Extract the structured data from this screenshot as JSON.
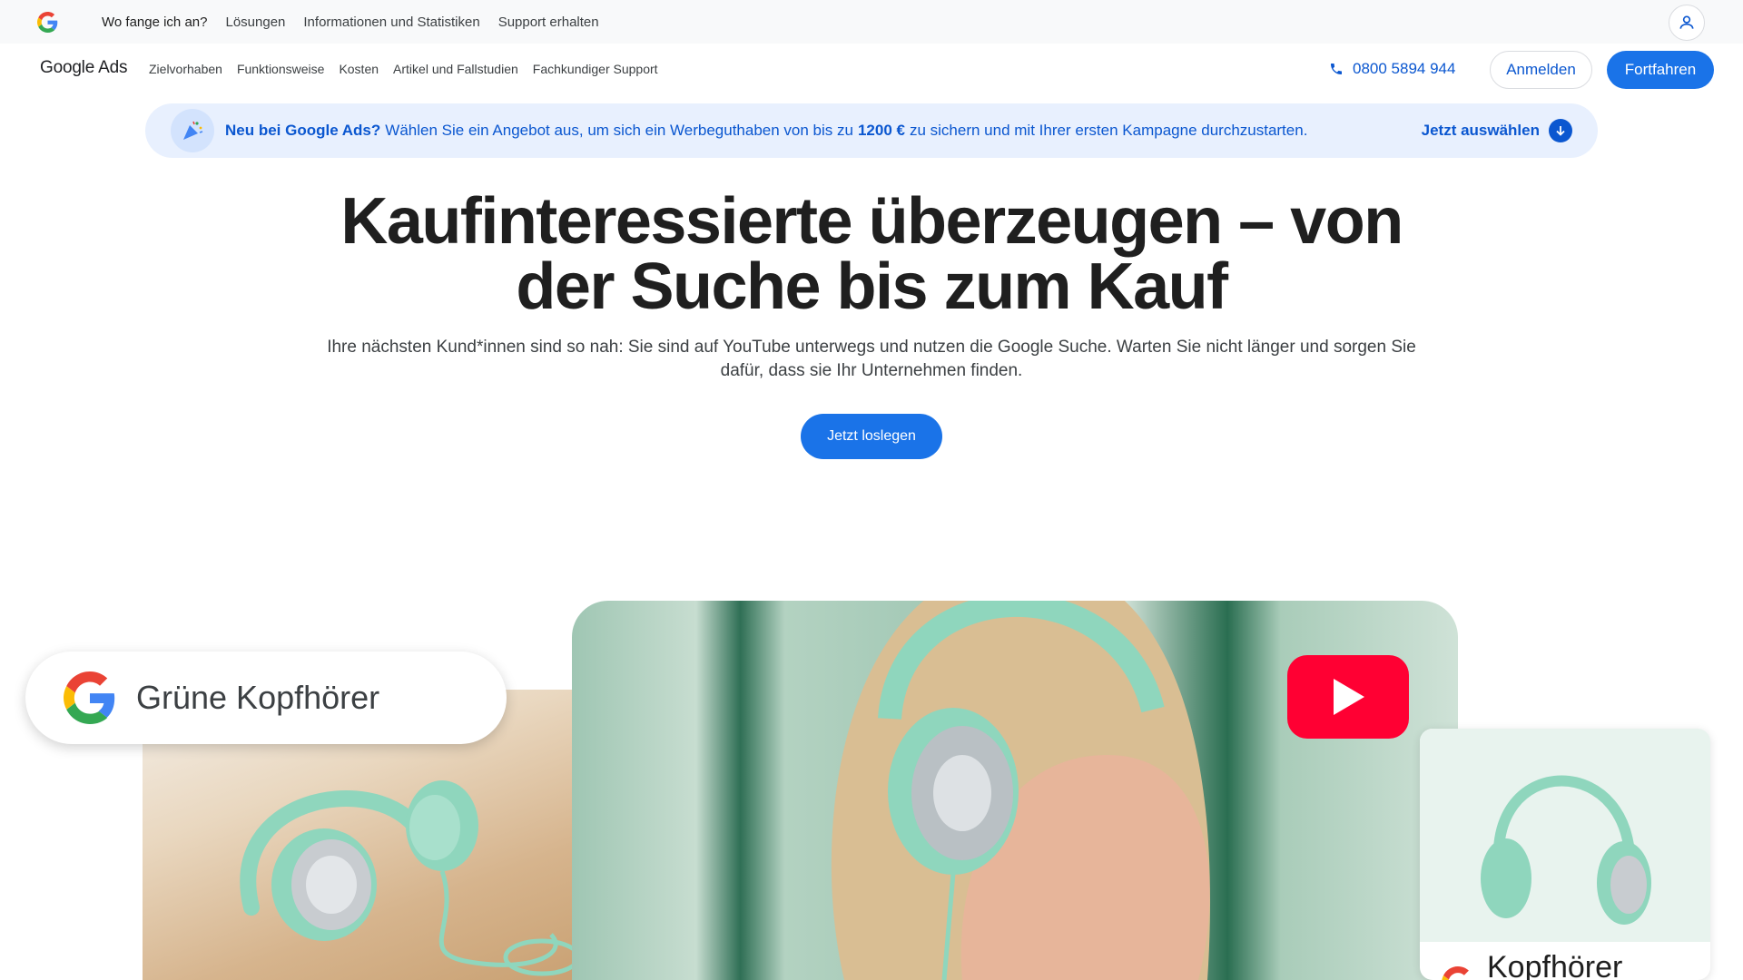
{
  "topbar": {
    "links": [
      "Wo fange ich an?",
      "Lösungen",
      "Informationen und Statistiken",
      "Support erhalten"
    ]
  },
  "nav": {
    "brand": "Google Ads",
    "links": [
      "Zielvorhaben",
      "Funktionsweise",
      "Kosten",
      "Artikel und Fallstudien",
      "Fachkundiger Support"
    ],
    "phone": "0800 5894 944",
    "login": "Anmelden",
    "continue": "Fortfahren"
  },
  "promo": {
    "lead": "Neu bei Google Ads?",
    "text_before": "Wählen Sie ein Angebot aus, um sich ein Werbeguthaben von bis zu",
    "amount": "1200 €",
    "text_after": "zu sichern und mit Ihrer ersten Kampagne durchzustarten.",
    "cta": "Jetzt auswählen"
  },
  "hero": {
    "title_line1": "Kaufinteressierte überzeugen – von",
    "title_line2": "der Suche bis zum Kauf",
    "subtitle_line1": "Ihre nächsten Kund*innen sind so nah: Sie sind auf YouTube unterwegs und nutzen die Google Suche. Warten Sie nicht länger und sorgen Sie",
    "subtitle_line2": "dafür, dass sie Ihr Unternehmen finden.",
    "cta": "Jetzt loslegen"
  },
  "visual": {
    "search_query": "Grüne Kopfhörer",
    "product_title": "Kopfhörer"
  },
  "colors": {
    "accent": "#1a73e8",
    "link": "#0b57d0",
    "promo_bg": "#e8f0fe",
    "youtube": "#ff0033",
    "mint": "#8fd6bd"
  }
}
